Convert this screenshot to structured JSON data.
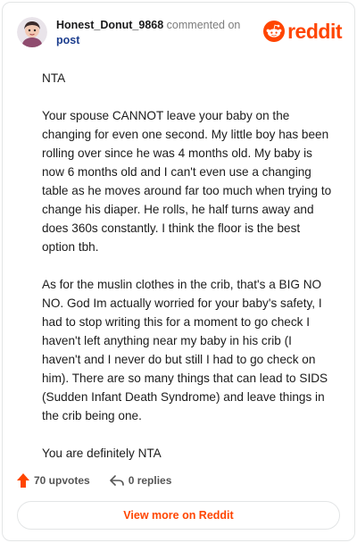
{
  "header": {
    "username": "Honest_Donut_9868",
    "action_text": "commented on",
    "post_link": "post",
    "logo_text": "reddit"
  },
  "comment": {
    "paragraphs": [
      "NTA",
      "Your spouse CANNOT leave your baby on the changing for even one second. My little boy has been rolling over since he was 4 months old. My baby is now 6 months old and I can't even use a changing table as he moves around far too much when trying to change his diaper. He rolls, he half turns away and does 360s constantly. I think the floor is the best option tbh.",
      "As for the muslin clothes in the crib, that's a BIG NO NO. God Im actually worried for your baby's safety, I had to stop writing this for a moment to go check I haven't left anything near my baby in his crib (I haven't and I never do but still I had to go check on him). There are so many things that can lead to SIDS (Sudden Infant Death Syndrome) and leave things in the crib being one.",
      "You are definitely NTA"
    ]
  },
  "footer": {
    "upvotes": "70 upvotes",
    "replies": "0 replies",
    "view_more": "View more on Reddit"
  },
  "colors": {
    "brand": "#ff4500",
    "link": "#1d3e8e"
  }
}
